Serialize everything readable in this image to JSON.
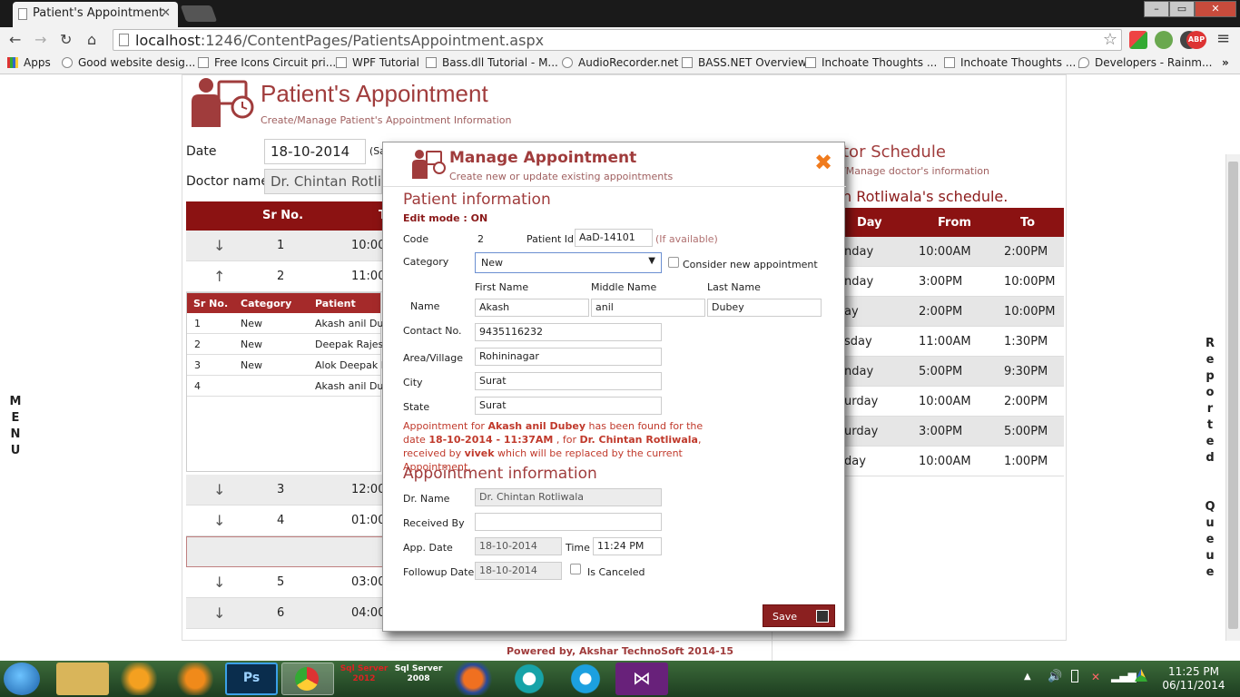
{
  "browser": {
    "tab_title": "Patient's Appointment",
    "url_host": "localhost",
    "url_rest": ":1246/ContentPages/PatientsAppointment.aspx",
    "bookmarks": [
      "Apps",
      "Good website desig...",
      "Free Icons Circuit pri...",
      "WPF Tutorial",
      "Bass.dll Tutorial - M...",
      "AudioRecorder.net",
      "BASS.NET Overview",
      "Inchoate Thoughts ...",
      "Inchoate Thoughts ...",
      "Developers - Rainm..."
    ]
  },
  "side": {
    "menu_letters": [
      "M",
      "E",
      "N",
      "U"
    ],
    "right_letters": [
      "R",
      "e",
      "p",
      "o",
      "r",
      "t",
      "e",
      "d",
      "",
      "",
      "Q",
      "u",
      "e",
      "u",
      "e"
    ]
  },
  "page": {
    "title": "Patient's Appointment",
    "subtitle": "Create/Manage Patient's Appointment Information",
    "date_label": "Date",
    "date_value": "18-10-2014",
    "date_hint": "(Sa",
    "doctor_label": "Doctor name",
    "doctor_value": "Dr.  Chintan Rotli",
    "grid_header": {
      "srno": "Sr No.",
      "time": "T"
    },
    "grid_rows_top": [
      {
        "arrow": "↓",
        "srno": "1",
        "time": "10:00"
      },
      {
        "arrow": "↑",
        "srno": "2",
        "time": "11:00"
      }
    ],
    "grid_rows_bottom": [
      {
        "arrow": "↓",
        "srno": "3",
        "time": "12:00"
      },
      {
        "arrow": "↓",
        "srno": "4",
        "time": "01:00"
      },
      {
        "arrow": "",
        "srno": "",
        "time": ""
      },
      {
        "arrow": "↓",
        "srno": "5",
        "time": "03:00"
      },
      {
        "arrow": "↓",
        "srno": "6",
        "time": "04:00"
      }
    ],
    "sub_table": {
      "headers": [
        "Sr No.",
        "Category",
        "Patient"
      ],
      "rows": [
        [
          "1",
          "New",
          "Akash anil Dub"
        ],
        [
          "2",
          "New",
          "Deepak Rajesh"
        ],
        [
          "3",
          "New",
          "Alok Deepak M"
        ],
        [
          "4",
          "",
          "Akash anil Dub"
        ]
      ]
    }
  },
  "doctor_panel": {
    "title": "tor Schedule",
    "subtitle": "/Manage doctor's information",
    "schedule_title": "n Rotliwala's schedule.",
    "headers": [
      "Day",
      "From",
      "To"
    ],
    "rows": [
      [
        "nday",
        "10:00AM",
        "2:00PM"
      ],
      [
        "nday",
        "3:00PM",
        "10:00PM"
      ],
      [
        "ay",
        "2:00PM",
        "10:00PM"
      ],
      [
        "sday",
        "11:00AM",
        "1:30PM"
      ],
      [
        "nday",
        "5:00PM",
        "9:30PM"
      ],
      [
        "urday",
        "10:00AM",
        "2:00PM"
      ],
      [
        "urday",
        "3:00PM",
        "5:00PM"
      ],
      [
        "day",
        "10:00AM",
        "1:00PM"
      ]
    ]
  },
  "modal": {
    "title": "Manage Appointment",
    "subtitle": "Create new or update existing appointments",
    "patient_section": "Patient information",
    "edit_mode": "Edit mode : ON",
    "code_label": "Code",
    "code_value": "2",
    "patient_id_label": "Patient Id",
    "patient_id_value": "AaD-14101",
    "patient_id_hint": "(If available)",
    "category_label": "Category",
    "category_value": "New",
    "consider_new_label": "Consider new appointment",
    "first_name_label": "First Name",
    "middle_name_label": "Middle Name",
    "last_name_label": "Last Name",
    "name_label": "Name",
    "first_name": "Akash",
    "middle_name": "anil",
    "last_name": "Dubey",
    "contact_label": "Contact No.",
    "contact_value": "9435116232",
    "area_label": "Area/Village",
    "area_value": "Rohininagar",
    "city_label": "City",
    "city_value": "Surat",
    "state_label": "State",
    "state_value": "Surat",
    "message": {
      "p1": "Appointment for ",
      "name": "Akash anil Dubey",
      "p2": " has been found for the date ",
      "datetime": "18-10-2014 - 11:37AM",
      "p3": " , for ",
      "doctor": "Dr. Chintan Rotliwala",
      "p4": ", received by ",
      "receiver": "vivek",
      "p5": " which will be replaced by the current Appointment."
    },
    "appointment_section": "Appointment information",
    "dr_name_label": "Dr. Name",
    "dr_name_value": "Dr. Chintan Rotliwala",
    "received_by_label": "Received By",
    "received_by_value": "",
    "app_date_label": "App. Date",
    "app_date_value": "18-10-2014",
    "time_label": "Time",
    "time_value": "11:24 PM",
    "followup_label": "Followup Date",
    "followup_value": "18-10-2014",
    "is_canceled_label": "Is Canceled",
    "save_label": "Save"
  },
  "footer": "Powered by, Akshar TechnoSoft 2014-15",
  "taskbar": {
    "sql2012_label": "Sql Server 2012",
    "sql2008_label": "Sql Server 2008",
    "time": "11:25 PM",
    "date": "06/11/2014"
  }
}
